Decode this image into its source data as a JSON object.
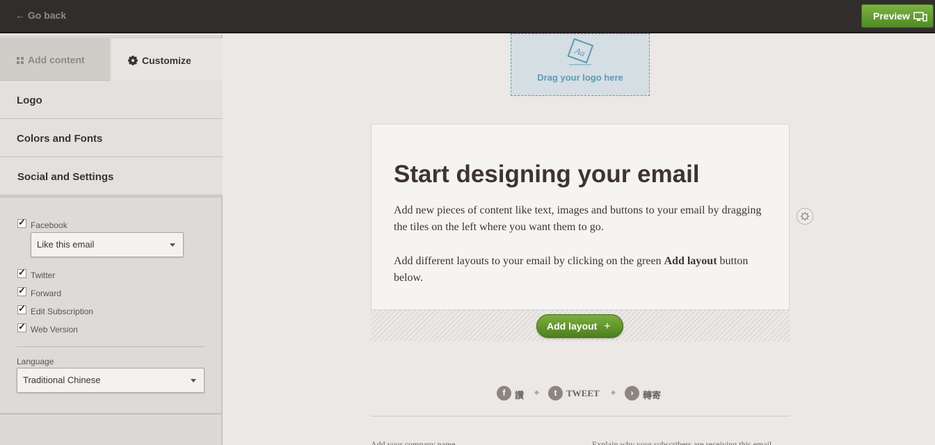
{
  "topbar": {
    "go_back": "← Go back",
    "preview": "Preview"
  },
  "sidebar": {
    "tabs": [
      {
        "label": "Add content",
        "icon": "grid-icon"
      },
      {
        "label": "Customize",
        "icon": "gear-icon"
      }
    ],
    "sections": [
      "Logo",
      "Colors and Fonts",
      "Social and Settings"
    ],
    "social_settings": {
      "facebook": {
        "label": "Facebook",
        "checked": true,
        "option": "Like this email"
      },
      "twitter": {
        "label": "Twitter",
        "checked": true
      },
      "forward": {
        "label": "Forward",
        "checked": true
      },
      "edit_subscription": {
        "label": "Edit Subscription",
        "checked": true
      },
      "web_version": {
        "label": "Web Version",
        "checked": true
      },
      "language_label": "Language",
      "language_value": "Traditional Chinese"
    }
  },
  "canvas": {
    "logo_drop": "Drag your logo here",
    "logo_glyph": "Aa",
    "heading": "Start designing your email",
    "paragraph1": "Add new pieces of content like text, images and buttons to your email by dragging the tiles on the left where you want them to go.",
    "paragraph2_prefix": "Add different layouts to your email by clicking on the green ",
    "paragraph2_bold": "Add layout",
    "paragraph2_suffix": " button below.",
    "add_layout": "Add layout",
    "social": [
      {
        "icon": "facebook-icon",
        "glyph": "f",
        "text": "讚"
      },
      {
        "icon": "twitter-icon",
        "glyph": "t",
        "text": "TWEET"
      },
      {
        "icon": "forward-icon",
        "glyph": "›",
        "text": "轉寄"
      }
    ],
    "footer_left": "Add your company name",
    "footer_right": "Explain why your subscribers are receiving this email"
  },
  "colors": {
    "topbar": "#322d2d",
    "accent_green": "#5b9130",
    "logo_drop_blue": "#5b9bb3"
  }
}
